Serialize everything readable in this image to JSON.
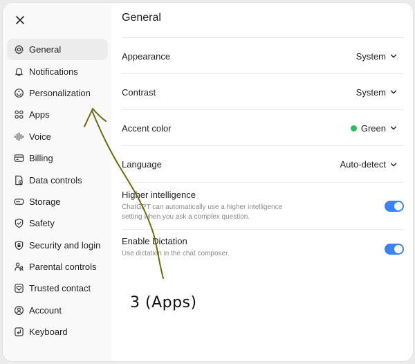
{
  "sidebar": {
    "items": [
      {
        "label": "General",
        "icon": "gear-icon",
        "active": true
      },
      {
        "label": "Notifications",
        "icon": "bell-icon"
      },
      {
        "label": "Personalization",
        "icon": "personalization-icon"
      },
      {
        "label": "Apps",
        "icon": "apps-grid-icon"
      },
      {
        "label": "Voice",
        "icon": "voice-waveform-icon"
      },
      {
        "label": "Billing",
        "icon": "credit-card-icon"
      },
      {
        "label": "Data controls",
        "icon": "data-controls-icon"
      },
      {
        "label": "Storage",
        "icon": "storage-icon"
      },
      {
        "label": "Safety",
        "icon": "shield-icon"
      },
      {
        "label": "Security and login",
        "icon": "security-icon"
      },
      {
        "label": "Parental controls",
        "icon": "parental-icon"
      },
      {
        "label": "Trusted contact",
        "icon": "trusted-contact-icon"
      },
      {
        "label": "Account",
        "icon": "account-icon"
      },
      {
        "label": "Keyboard",
        "icon": "keyboard-icon"
      }
    ]
  },
  "main": {
    "title": "General",
    "settings": [
      {
        "label": "Appearance",
        "value": "System"
      },
      {
        "label": "Contrast",
        "value": "System"
      },
      {
        "label": "Accent color",
        "value": "Green",
        "swatch": "#2fbc5b"
      },
      {
        "label": "Language",
        "value": "Auto-detect"
      }
    ],
    "toggles": [
      {
        "title": "Higher intelligence",
        "description": "ChatGPT can automatically use a higher intelligence setting when you ask a complex question.",
        "on": true
      },
      {
        "title": "Enable Dictation",
        "description": "Use dictation in the chat composer.",
        "on": true
      }
    ]
  },
  "annotation": {
    "text": "3 (Apps)",
    "stroke_color": "#6b6b12"
  },
  "colors": {
    "accent": "#3b82f6",
    "active_nav_bg": "#ececec",
    "green": "#2fbc5b"
  }
}
